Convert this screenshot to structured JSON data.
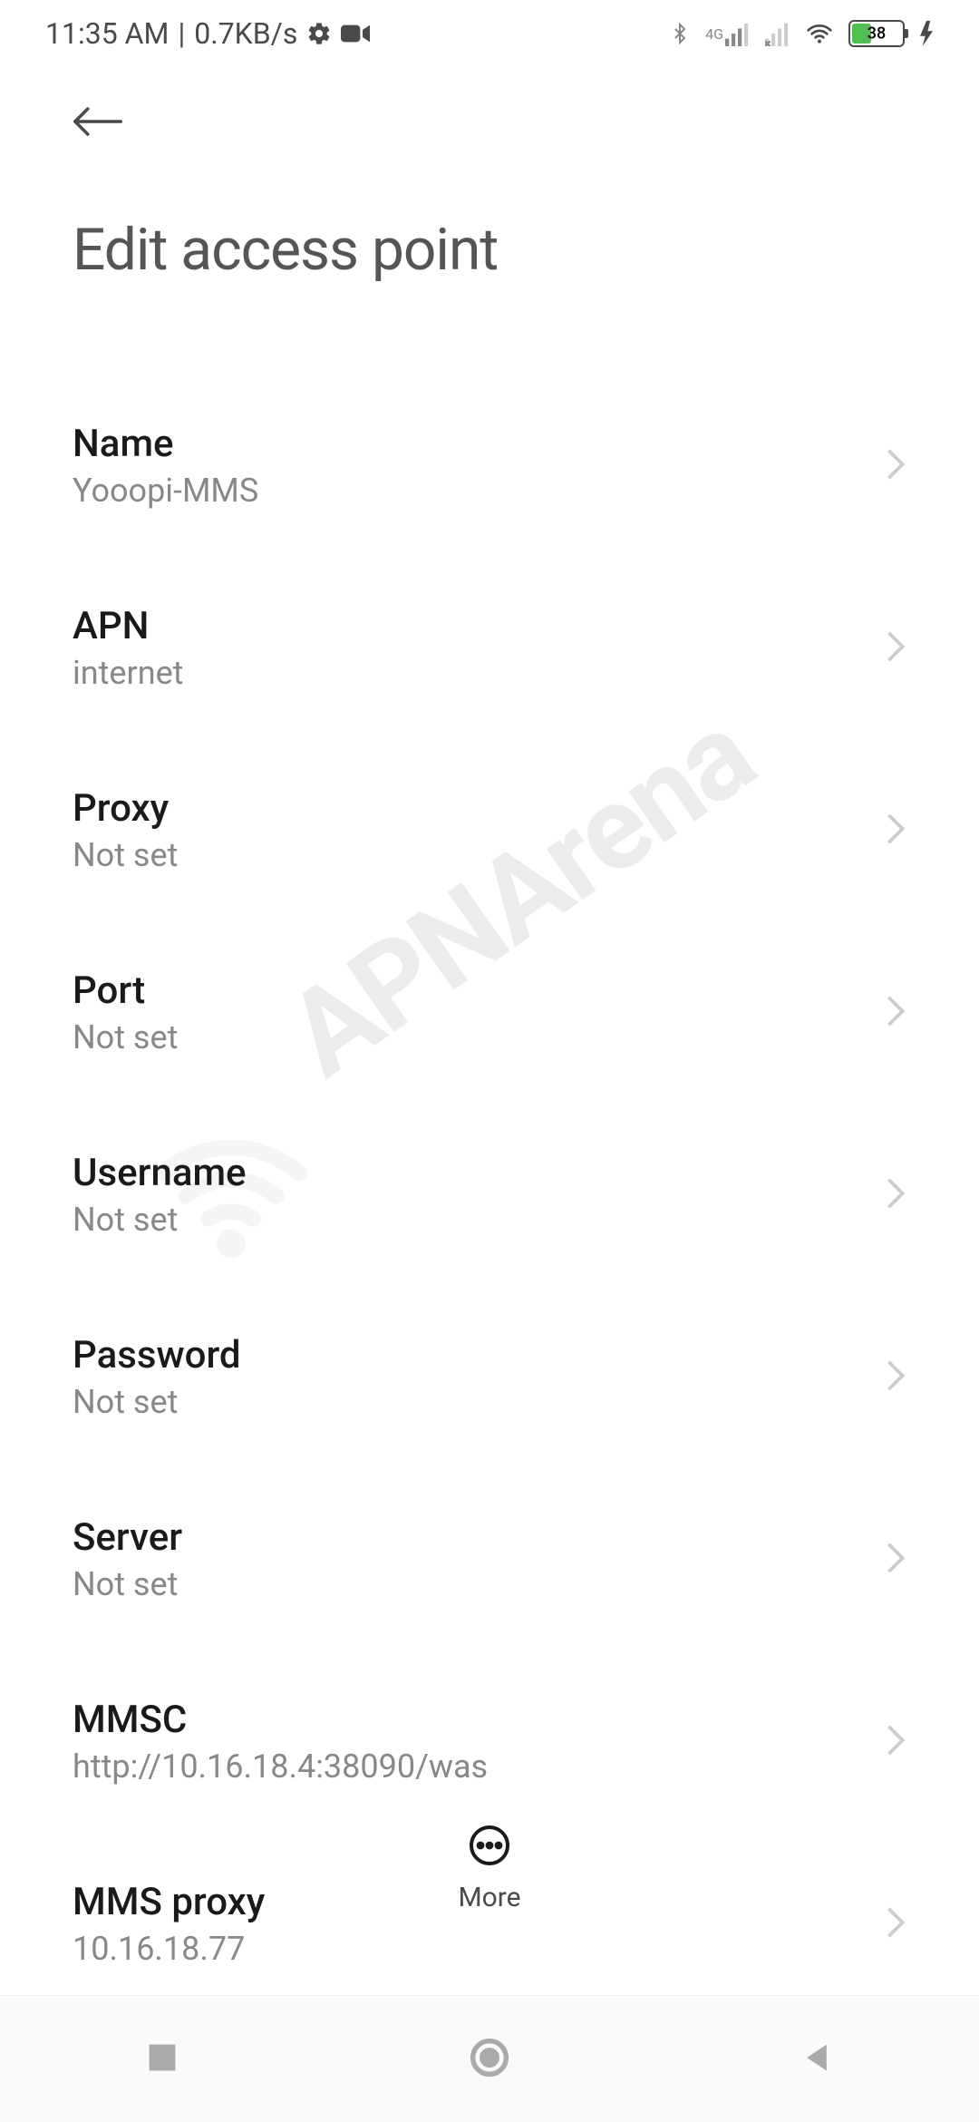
{
  "status_bar": {
    "time": "11:35 AM",
    "separator": "|",
    "data_rate": "0.7KB/s",
    "network_label": "4G",
    "battery_percent": "38"
  },
  "header": {
    "title": "Edit access point"
  },
  "settings": {
    "items": [
      {
        "label": "Name",
        "value": "Yooopi-MMS"
      },
      {
        "label": "APN",
        "value": "internet"
      },
      {
        "label": "Proxy",
        "value": "Not set"
      },
      {
        "label": "Port",
        "value": "Not set"
      },
      {
        "label": "Username",
        "value": "Not set"
      },
      {
        "label": "Password",
        "value": "Not set"
      },
      {
        "label": "Server",
        "value": "Not set"
      },
      {
        "label": "MMSC",
        "value": "http://10.16.18.4:38090/was"
      },
      {
        "label": "MMS proxy",
        "value": "10.16.18.77"
      }
    ]
  },
  "bottom": {
    "more_label": "More"
  },
  "watermark": {
    "text": "APNArena"
  }
}
